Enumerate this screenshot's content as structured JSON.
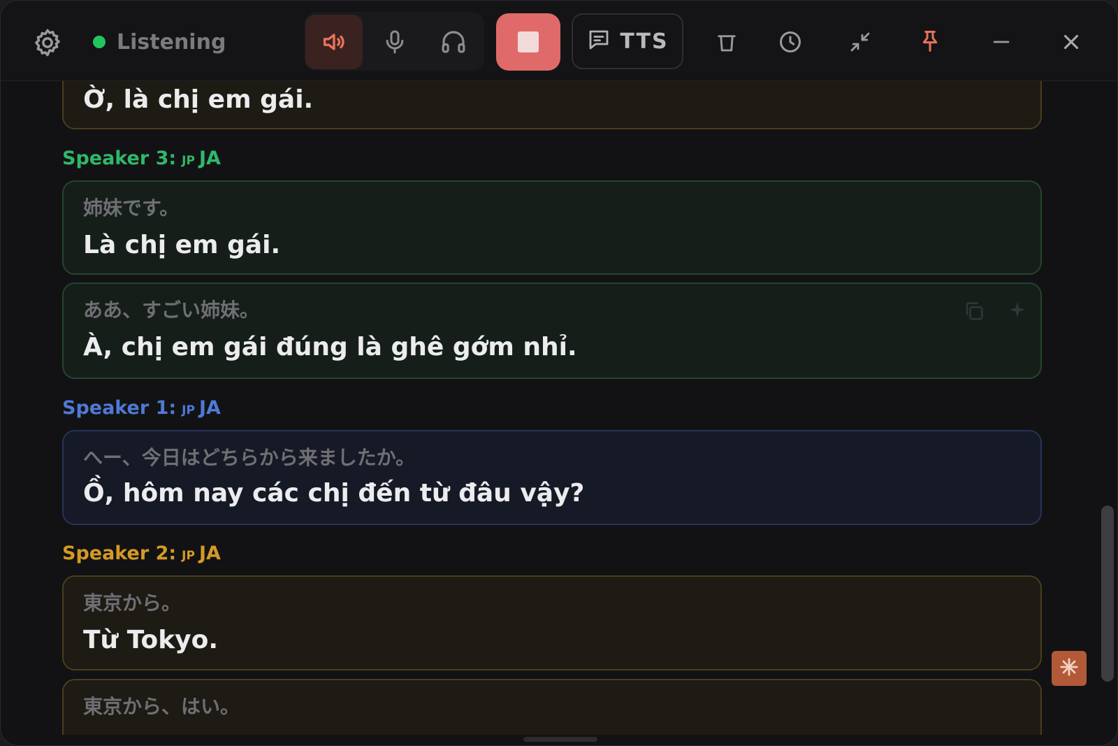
{
  "toolbar": {
    "status_text": "Listening",
    "tts_label": "TTS",
    "icons": {
      "settings": "gear-icon",
      "speaker": "speaker-icon",
      "mic": "microphone-icon",
      "headphones": "headphones-icon",
      "stop": "stop-icon",
      "tts": "chat-bubble-icon",
      "clear": "trash-icon",
      "history": "clock-icon",
      "compact": "minimize-arrows-icon",
      "pin": "pin-icon",
      "minimize": "minus-icon",
      "close": "close-icon"
    },
    "colors": {
      "status_dot": "#22c55e",
      "stop_button": "#e06a6a",
      "accent_active": "#e8735c"
    }
  },
  "transcript": [
    {
      "type": "card",
      "tone": "amber",
      "translation": "Ờ, là chị em gái."
    },
    {
      "type": "speaker",
      "name": "Speaker 3:",
      "flag": "JP",
      "lang": "JA",
      "color": "#2fb86a"
    },
    {
      "type": "card",
      "tone": "green",
      "original": "姉妹です。",
      "translation": "Là chị em gái."
    },
    {
      "type": "card",
      "tone": "green",
      "original": "ああ、すごい姉妹。",
      "translation": "À, chị em gái đúng là ghê gớm nhỉ."
    },
    {
      "type": "speaker",
      "name": "Speaker 1:",
      "flag": "JP",
      "lang": "JA",
      "color": "#4f79d6"
    },
    {
      "type": "card",
      "tone": "blue",
      "original": "へー、今日はどちらから来ましたか。",
      "translation": "Ồ, hôm nay các chị đến từ đâu vậy?"
    },
    {
      "type": "speaker",
      "name": "Speaker 2:",
      "flag": "JP",
      "lang": "JA",
      "color": "#d49a24"
    },
    {
      "type": "card",
      "tone": "amber",
      "original": "東京から。",
      "translation": "Từ Tokyo."
    },
    {
      "type": "card",
      "tone": "amber",
      "original": "東京から、はい。"
    }
  ],
  "card_tools": {
    "copy": "copy-icon",
    "sparkle": "sparkle-icon"
  },
  "fab": {
    "icon": "sparkle-icon",
    "color": "#b25a38"
  }
}
